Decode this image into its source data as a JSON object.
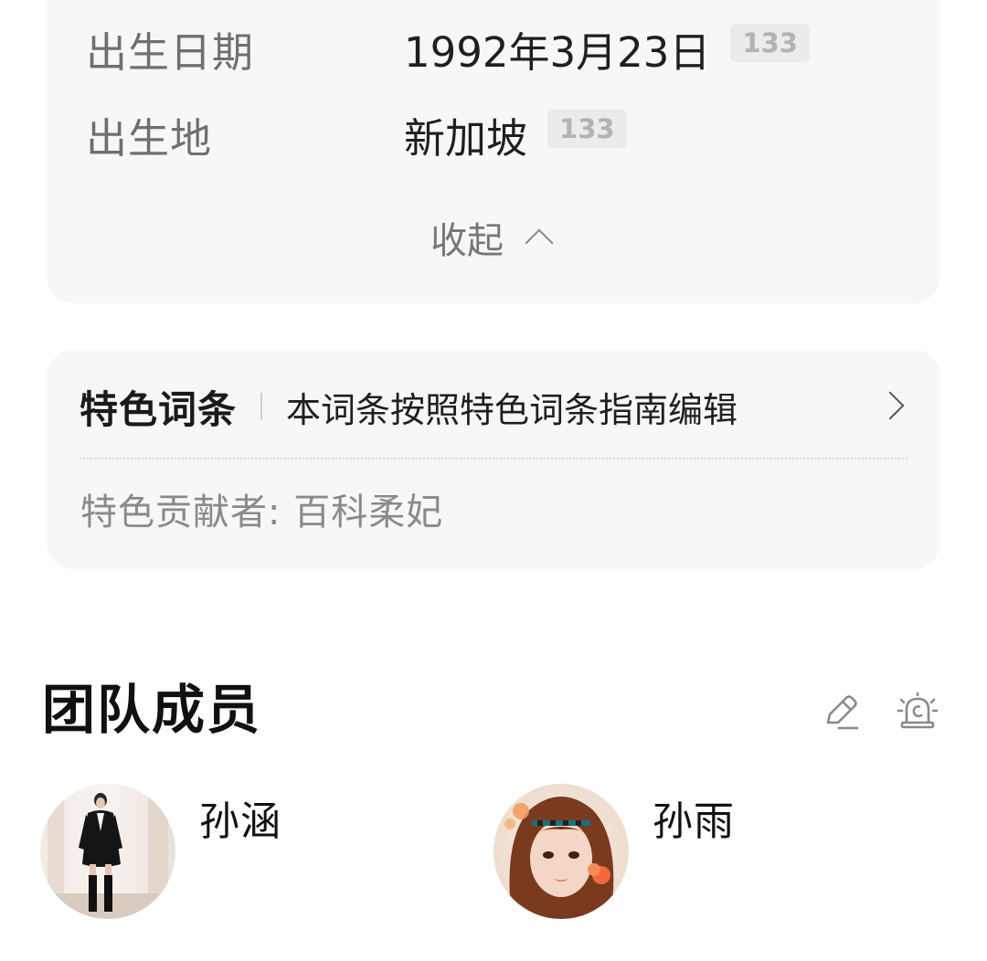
{
  "info": {
    "rows": [
      {
        "label": "出生日期",
        "value": "1992年3月23日",
        "badge": "133"
      },
      {
        "label": "出生地",
        "value": "新加坡",
        "badge": "133"
      }
    ],
    "collapse_label": "收起"
  },
  "featured": {
    "title": "特色词条",
    "description": "本词条按照特色词条指南编辑",
    "contributor_label": "特色贡献者:",
    "contributor_name": "百科柔妃"
  },
  "team": {
    "title": "团队成员",
    "members": [
      {
        "name": "孙涵",
        "avatar_icon": "avatar-photo"
      },
      {
        "name": "孙雨",
        "avatar_icon": "avatar-photo"
      }
    ]
  },
  "icons": {
    "edit": "edit-pencil-icon",
    "alarm": "alarm-light-icon"
  },
  "colors": {
    "card_bg": "#f7f7f7",
    "label_gray": "#6f6f6f",
    "badge_bg": "#ebebeb",
    "badge_text": "#b3b3b3"
  }
}
